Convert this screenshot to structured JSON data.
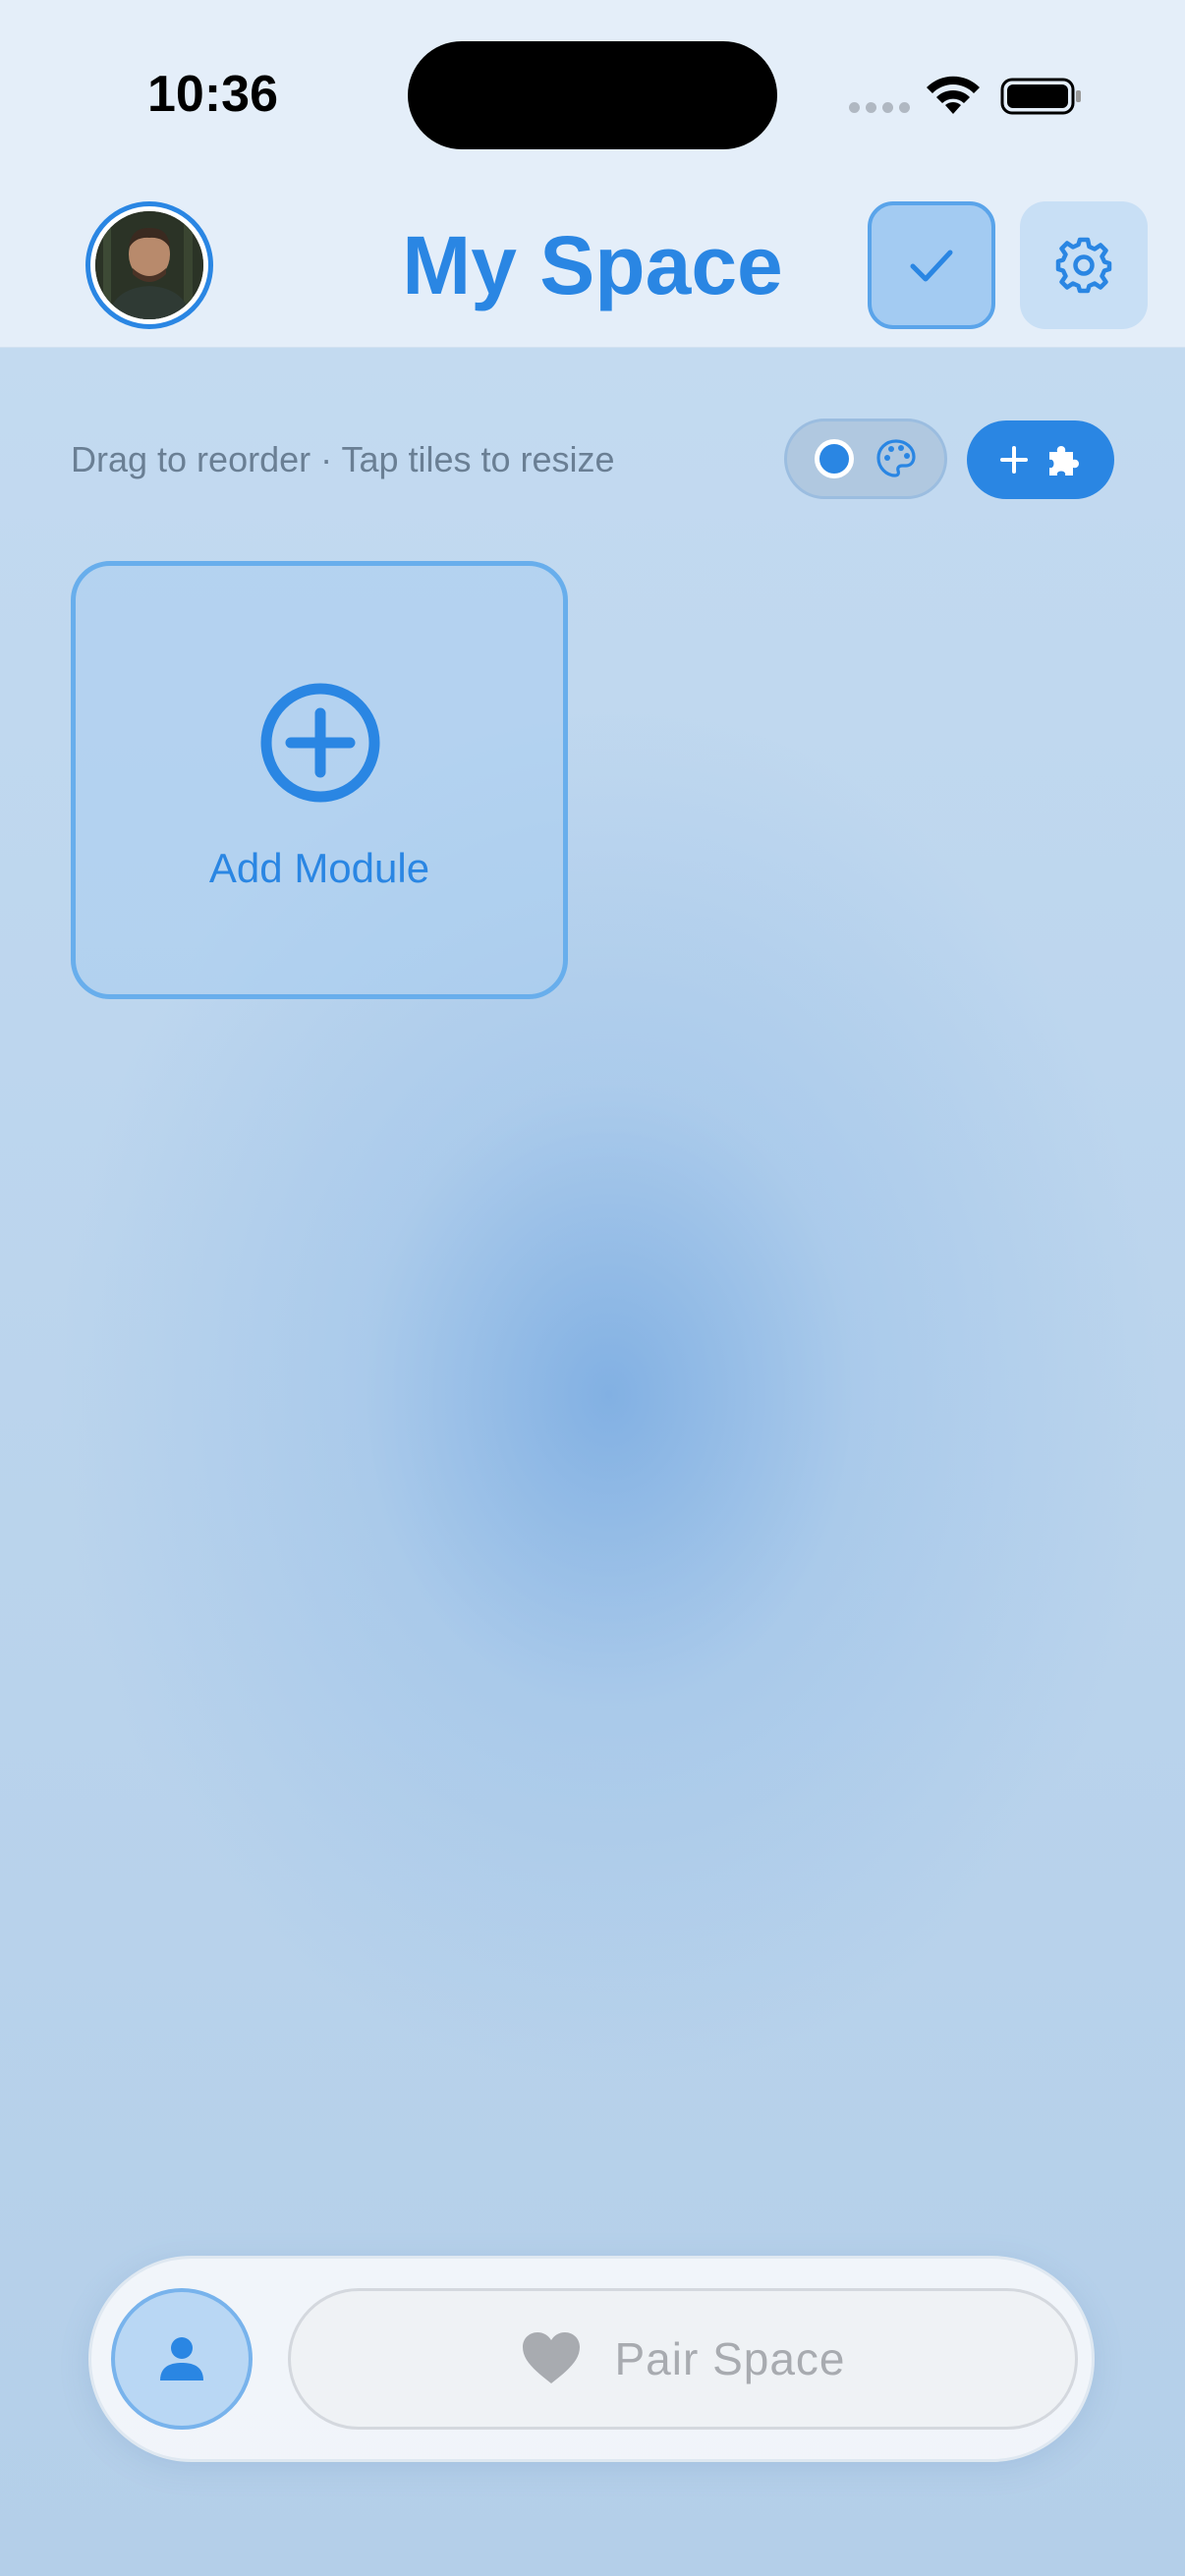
{
  "status_bar": {
    "time": "10:36"
  },
  "header": {
    "title": "My Space",
    "avatar_icon": "avatar-photo",
    "check_icon": "checkmark-icon",
    "settings_icon": "gear-icon"
  },
  "toolbar": {
    "hint": "Drag to reorder · Tap tiles to resize",
    "theme_toggle_icon": "palette-icon",
    "add_plugin_icon": "puzzle-icon"
  },
  "grid": {
    "add_module_label": "Add Module",
    "add_module_icon": "plus-circle-icon"
  },
  "bottom_bar": {
    "profile_icon": "person-icon",
    "pair_label": "Pair Space",
    "pair_icon": "heart-icon"
  },
  "colors": {
    "accent": "#2a86e3",
    "header_bg": "#e4eef9",
    "muted_text": "#6a7f94",
    "pair_text": "#a8abb0"
  }
}
